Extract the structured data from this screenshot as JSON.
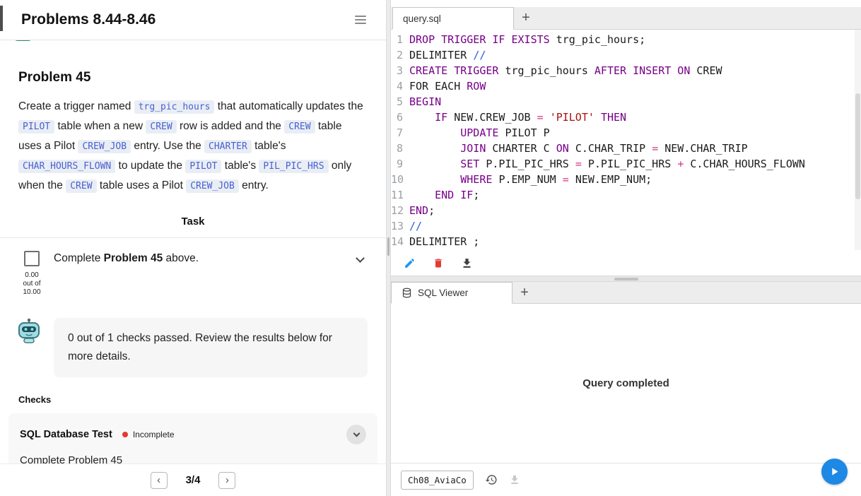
{
  "colors": {
    "chip_bg": "#e9eef5",
    "chip_text": "#4a5fd0",
    "keyword": "#770088",
    "string": "#aa1111",
    "operator": "#d33682",
    "comment": "#2b5ce0",
    "error_red": "#e53935",
    "play_blue": "#1e88e5",
    "edit_blue": "#2196f3",
    "delete_red": "#e53935"
  },
  "icons": {
    "menu": "hamburger",
    "task_expand": "chevron-down",
    "check_expand": "chevron-down",
    "edit": "pencil",
    "delete": "trash",
    "export": "download",
    "viewer_tab": "database",
    "history": "restore",
    "import": "download-tray",
    "run": "play"
  },
  "left_panel": {
    "header": {
      "title": "Problems 8.44-8.46"
    },
    "problem": {
      "title": "Problem 45",
      "description_segments": [
        {
          "t": "text",
          "v": "Create a trigger named "
        },
        {
          "t": "code",
          "v": "trg_pic_hours"
        },
        {
          "t": "text",
          "v": " that automatically updates the "
        },
        {
          "t": "code",
          "v": "PILOT"
        },
        {
          "t": "text",
          "v": " table when a new "
        },
        {
          "t": "code",
          "v": "CREW"
        },
        {
          "t": "text",
          "v": " row is added and the "
        },
        {
          "t": "code",
          "v": "CREW"
        },
        {
          "t": "text",
          "v": " table uses a Pilot "
        },
        {
          "t": "code",
          "v": "CREW_JOB"
        },
        {
          "t": "text",
          "v": " entry. Use the "
        },
        {
          "t": "code",
          "v": "CHARTER"
        },
        {
          "t": "text",
          "v": " table's "
        },
        {
          "t": "code",
          "v": "CHAR_HOURS_FLOWN"
        },
        {
          "t": "text",
          "v": " to update the "
        },
        {
          "t": "code",
          "v": "PILOT"
        },
        {
          "t": "text",
          "v": " table's "
        },
        {
          "t": "code",
          "v": "PIL_PIC_HRS"
        },
        {
          "t": "text",
          "v": " only when the "
        },
        {
          "t": "code",
          "v": "CREW"
        },
        {
          "t": "text",
          "v": " table uses a Pilot "
        },
        {
          "t": "code",
          "v": "CREW_JOB"
        },
        {
          "t": "text",
          "v": " entry."
        }
      ]
    },
    "task": {
      "heading": "Task",
      "label_segments": [
        {
          "t": "text",
          "v": "Complete "
        },
        {
          "t": "bold",
          "v": "Problem 45"
        },
        {
          "t": "text",
          "v": " above."
        }
      ],
      "score_lines": [
        "0.00",
        "out of",
        "10.00"
      ]
    },
    "feedback": {
      "message": "0 out of 1 checks passed. Review the results below for more details."
    },
    "checks": {
      "heading": "Checks",
      "items": [
        {
          "title": "SQL Database Test",
          "status": "Incomplete",
          "description": "Complete Problem 45"
        }
      ]
    },
    "pagination": {
      "prev": "‹",
      "current": "3/4",
      "next": "›"
    }
  },
  "editor": {
    "tab_label": "query.sql",
    "new_tab": "+",
    "lines": [
      {
        "n": "1",
        "t": [
          {
            "c": "kw",
            "v": "DROP TRIGGER IF EXISTS "
          },
          {
            "c": "id",
            "v": "trg_pic_hours;"
          }
        ]
      },
      {
        "n": "2",
        "t": [
          {
            "c": "id",
            "v": "DELIMITER "
          },
          {
            "c": "cmt",
            "v": "//"
          }
        ]
      },
      {
        "n": "3",
        "t": [
          {
            "c": "kw",
            "v": "CREATE TRIGGER "
          },
          {
            "c": "id",
            "v": "trg_pic_hours "
          },
          {
            "c": "kw",
            "v": "AFTER INSERT ON "
          },
          {
            "c": "id",
            "v": "CREW"
          }
        ]
      },
      {
        "n": "4",
        "t": [
          {
            "c": "id",
            "v": "FOR EACH "
          },
          {
            "c": "kw",
            "v": "ROW"
          }
        ]
      },
      {
        "n": "5",
        "t": [
          {
            "c": "kw",
            "v": "BEGIN"
          }
        ]
      },
      {
        "n": "6",
        "t": [
          {
            "c": "id",
            "v": "    "
          },
          {
            "c": "kw",
            "v": "IF "
          },
          {
            "c": "id",
            "v": "NEW.CREW_JOB "
          },
          {
            "c": "op",
            "v": "= "
          },
          {
            "c": "str",
            "v": "'PILOT' "
          },
          {
            "c": "kw",
            "v": "THEN"
          }
        ]
      },
      {
        "n": "7",
        "t": [
          {
            "c": "id",
            "v": "        "
          },
          {
            "c": "kw",
            "v": "UPDATE "
          },
          {
            "c": "id",
            "v": "PILOT P"
          }
        ]
      },
      {
        "n": "8",
        "t": [
          {
            "c": "id",
            "v": "        "
          },
          {
            "c": "kw",
            "v": "JOIN "
          },
          {
            "c": "id",
            "v": "CHARTER C "
          },
          {
            "c": "kw",
            "v": "ON "
          },
          {
            "c": "id",
            "v": "C.CHAR_TRIP "
          },
          {
            "c": "op",
            "v": "= "
          },
          {
            "c": "id",
            "v": "NEW.CHAR_TRIP"
          }
        ]
      },
      {
        "n": "9",
        "t": [
          {
            "c": "id",
            "v": "        "
          },
          {
            "c": "kw",
            "v": "SET "
          },
          {
            "c": "id",
            "v": "P.PIL_PIC_HRS "
          },
          {
            "c": "op",
            "v": "= "
          },
          {
            "c": "id",
            "v": "P.PIL_PIC_HRS "
          },
          {
            "c": "op",
            "v": "+ "
          },
          {
            "c": "id",
            "v": "C.CHAR_HOURS_FLOWN"
          }
        ]
      },
      {
        "n": "10",
        "t": [
          {
            "c": "id",
            "v": "        "
          },
          {
            "c": "kw",
            "v": "WHERE "
          },
          {
            "c": "id",
            "v": "P.EMP_NUM "
          },
          {
            "c": "op",
            "v": "= "
          },
          {
            "c": "id",
            "v": "NEW.EMP_NUM;"
          }
        ]
      },
      {
        "n": "11",
        "t": [
          {
            "c": "id",
            "v": "    "
          },
          {
            "c": "kw",
            "v": "END IF"
          },
          {
            "c": "id",
            "v": ";"
          }
        ]
      },
      {
        "n": "12",
        "t": [
          {
            "c": "kw",
            "v": "END"
          },
          {
            "c": "id",
            "v": ";"
          }
        ]
      },
      {
        "n": "13",
        "t": [
          {
            "c": "cmt",
            "v": "//"
          }
        ]
      },
      {
        "n": "14",
        "t": [
          {
            "c": "id",
            "v": "DELIMITER ;"
          }
        ]
      }
    ]
  },
  "viewer": {
    "tab_label": "SQL Viewer",
    "new_tab": "+",
    "message": "Query completed"
  },
  "footer": {
    "database": "Ch08_AviaCo"
  }
}
